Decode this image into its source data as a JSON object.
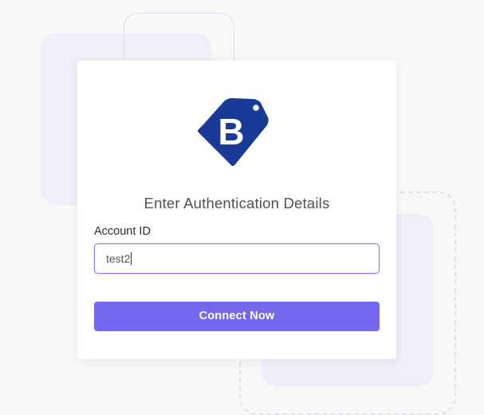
{
  "brand": {
    "logo_icon": "b-price-tag-icon",
    "logo_letter": "B",
    "color": "#1a3a98"
  },
  "auth": {
    "heading": "Enter Authentication Details",
    "account_id": {
      "label": "Account ID",
      "value": "test2"
    },
    "connect_label": "Connect Now"
  },
  "colors": {
    "accent": "#7468ee",
    "input_border": "#7b73ee",
    "background": "#f8f8f9",
    "decor_lavender": "#efeff9"
  }
}
